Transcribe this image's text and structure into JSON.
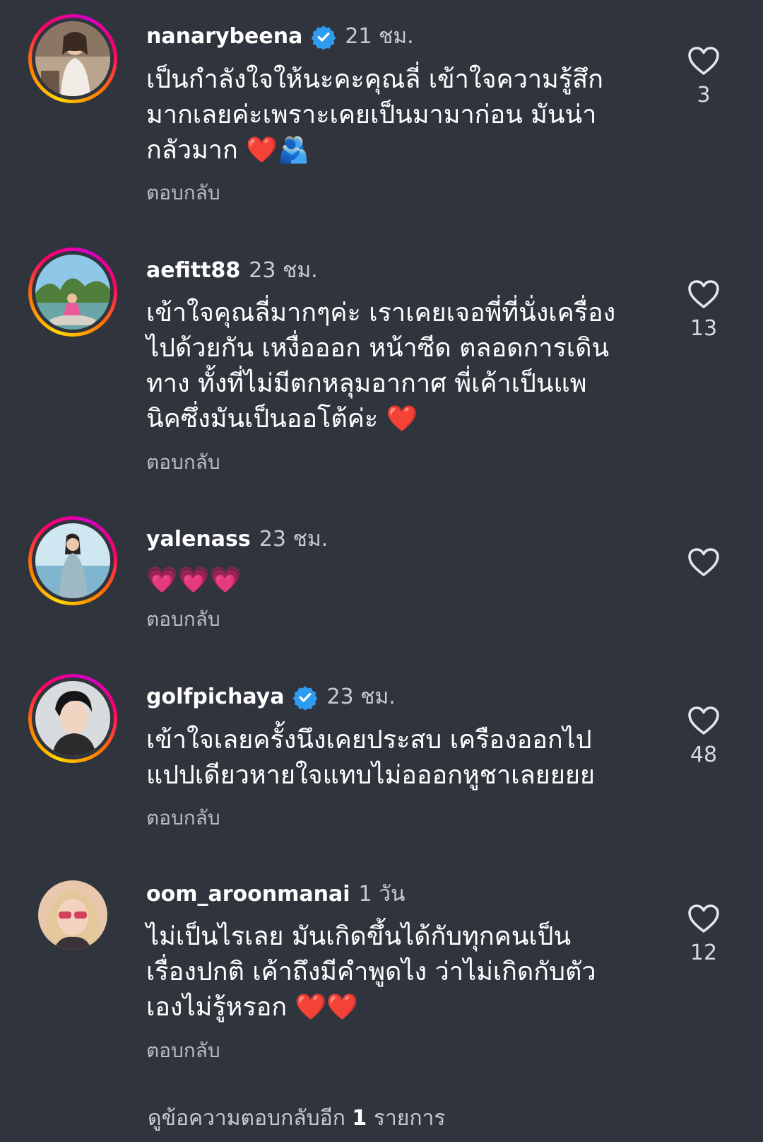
{
  "comments": [
    {
      "username": "nanarybeena",
      "verified": true,
      "time": "21 ชม.",
      "text": "เป็นกำลังใจให้นะคะคุณลี่ เข้าใจความรู้สึก\nมากเลยค่ะเพราะเคยเป็นมามาก่อน  มันน่า\nกลัวมาก ❤️🫂",
      "reply_label": "ตอบกลับ",
      "likes": "3",
      "story_ring": true
    },
    {
      "username": "aefitt88",
      "verified": false,
      "time": "23 ชม.",
      "text": "เข้าใจคุณลี่มากๆค่ะ เราเคยเจอพี่ที่นั่งเครื่อง\nไปด้วยกัน เหงื่อออก หน้าซีด ตลอดการเดิน\nทาง ทั้งที่ไม่มีตกหลุมอากาศ พี่เค้าเป็นแพ\nนิคซึ่งมันเป็นออโต้ค่ะ ❤️",
      "reply_label": "ตอบกลับ",
      "likes": "13",
      "story_ring": true
    },
    {
      "username": "yalenass",
      "verified": false,
      "time": "23 ชม.",
      "text": "💗💗💗",
      "reply_label": "ตอบกลับ",
      "likes": "",
      "story_ring": true
    },
    {
      "username": "golfpichaya",
      "verified": true,
      "time": "23 ชม.",
      "text": "เข้าใจเลยครั้งนึงเคยประสบ เครืองออกไป\nแปปเดียวหายใจแทบไม่อออกหูชาเลยยยย",
      "reply_label": "ตอบกลับ",
      "likes": "48",
      "story_ring": true
    },
    {
      "username": "oom_aroonmanai",
      "verified": false,
      "time": "1 วัน",
      "text": "ไม่เป็นไรเลย มันเกิดขึ้นได้กับทุกคนเป็น\nเรื่องปกติ เค้าถึงมีคำพูดไง ว่าไม่เกิดกับตัว\nเองไม่รู้หรอก ❤️❤️",
      "reply_label": "ตอบกลับ",
      "likes": "12",
      "story_ring": false
    }
  ],
  "view_more": {
    "prefix": "ดูข้อความตอบกลับอีก",
    "count": "1",
    "suffix": "รายการ"
  },
  "colors": {
    "background": "#30343d",
    "verified_badge": "#2d9cf0",
    "muted_text": "#c8cad0"
  },
  "icons": {
    "like": "heart-outline-icon",
    "verified": "verified-badge-icon"
  }
}
